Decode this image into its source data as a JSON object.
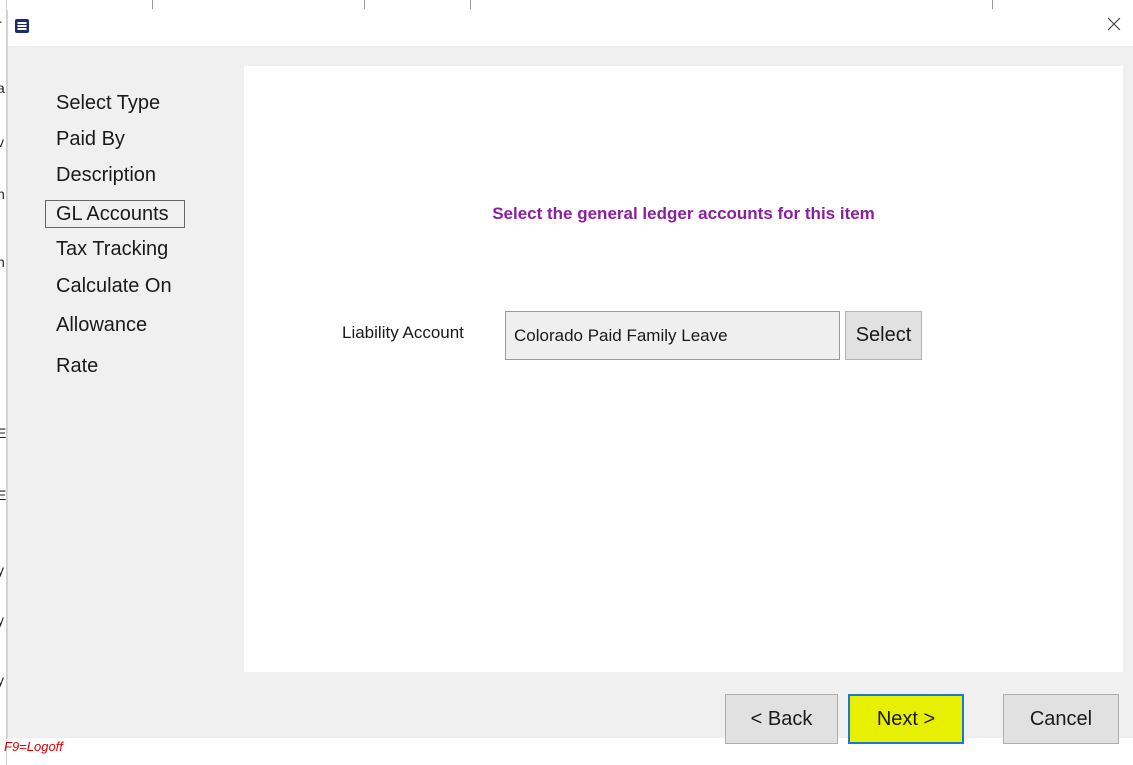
{
  "dialog": {
    "close_symbol": "✕",
    "icons": {
      "app": "app-logo-icon",
      "close": "close-icon"
    }
  },
  "steps": [
    {
      "label": "Select Type",
      "current": false
    },
    {
      "label": "Paid By",
      "current": false
    },
    {
      "label": "Description",
      "current": false
    },
    {
      "label": "GL Accounts",
      "current": true
    },
    {
      "label": "Tax Tracking",
      "current": false
    },
    {
      "label": "Calculate On",
      "current": false
    },
    {
      "label": "Allowance",
      "current": false
    },
    {
      "label": "Rate",
      "current": false
    }
  ],
  "content": {
    "heading": "Select the general ledger accounts for this item",
    "liability_label": "Liability Account",
    "liability_value": "Colorado Paid Family Leave",
    "select_label": "Select"
  },
  "footer": {
    "back_label": "< Back",
    "next_label": "Next >",
    "cancel_label": "Cancel"
  },
  "background": {
    "status_text": "F9=Logoff",
    "edge_letters": [
      "r",
      "a",
      "v",
      "n",
      "n",
      "E",
      "E",
      "y",
      "y",
      "y"
    ]
  },
  "colors": {
    "heading": "#8b1fa0",
    "next_highlight": "#e6f000",
    "focus_border": "#1a78d6",
    "status_text": "#e00000"
  }
}
